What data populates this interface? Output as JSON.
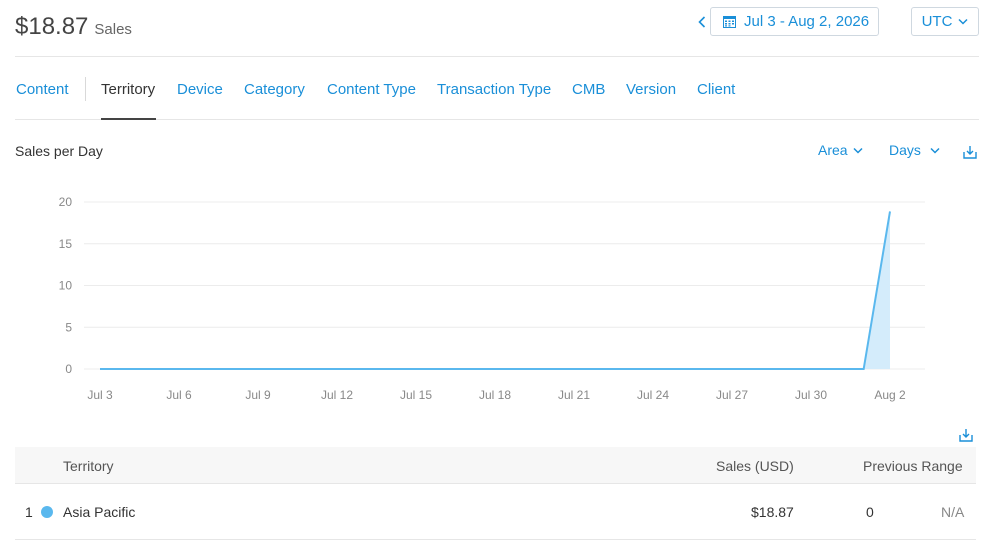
{
  "summary": {
    "total": "$18.87",
    "label": "Sales"
  },
  "date_range": {
    "label": "Jul 3 - Aug 2, 2026",
    "prev_icon": "chevron-left-icon",
    "calendar_icon": "calendar-icon"
  },
  "timezone": {
    "value": "UTC"
  },
  "tabs": [
    {
      "label": "Content"
    },
    {
      "label": "Territory",
      "active": true
    },
    {
      "label": "Device"
    },
    {
      "label": "Category"
    },
    {
      "label": "Content Type"
    },
    {
      "label": "Transaction Type"
    },
    {
      "label": "CMB"
    },
    {
      "label": "Version"
    },
    {
      "label": "Client"
    }
  ],
  "chart_controls": {
    "title": "Sales per Day",
    "type_select": "Area",
    "interval_select": "Days"
  },
  "chart_data": {
    "type": "area",
    "title": "Sales per Day",
    "xlabel": "",
    "ylabel": "",
    "ylim": [
      0,
      20
    ],
    "yticks": [
      "0",
      "5",
      "10",
      "15",
      "20"
    ],
    "xticks": [
      "Jul 3",
      "Jul 6",
      "Jul 9",
      "Jul 12",
      "Jul 15",
      "Jul 18",
      "Jul 21",
      "Jul 24",
      "Jul 27",
      "Jul 30",
      "Aug 2"
    ],
    "x": [
      "Jul 3",
      "Jul 4",
      "Jul 5",
      "Jul 6",
      "Jul 7",
      "Jul 8",
      "Jul 9",
      "Jul 10",
      "Jul 11",
      "Jul 12",
      "Jul 13",
      "Jul 14",
      "Jul 15",
      "Jul 16",
      "Jul 17",
      "Jul 18",
      "Jul 19",
      "Jul 20",
      "Jul 21",
      "Jul 22",
      "Jul 23",
      "Jul 24",
      "Jul 25",
      "Jul 26",
      "Jul 27",
      "Jul 28",
      "Jul 29",
      "Jul 30",
      "Jul 31",
      "Aug 1",
      "Aug 2"
    ],
    "series": [
      {
        "values": [
          0,
          0,
          0,
          0,
          0,
          0,
          0,
          0,
          0,
          0,
          0,
          0,
          0,
          0,
          0,
          0,
          0,
          0,
          0,
          0,
          0,
          0,
          0,
          0,
          0,
          0,
          0,
          0,
          0,
          0,
          18.87
        ]
      }
    ],
    "grid": true,
    "colors": {
      "line": "#5ab8ee",
      "fill": "#d4ecfb",
      "grid": "#ececec"
    }
  },
  "table": {
    "headers": {
      "territory": "Territory",
      "sales": "Sales (USD)",
      "previous": "Previous Range"
    },
    "rows": [
      {
        "rank": "1",
        "territory": "Asia Pacific",
        "sales": "$18.87",
        "previous": "0",
        "change": "N/A",
        "color": "#5ab8ee"
      }
    ]
  },
  "icons": {
    "download": "download-icon",
    "chevron_down": "chevron-down-icon"
  },
  "accent": "#1a8fd8"
}
